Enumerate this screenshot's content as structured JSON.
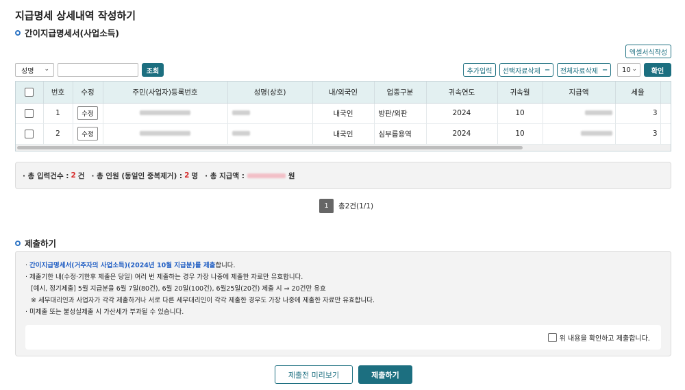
{
  "page_title": "지급명세 상세내역 작성하기",
  "section1_title": "간이지급명세서(사업소득)",
  "excel_button": "엑셀서식작성",
  "search": {
    "select_value": "성명",
    "query_button": "조회"
  },
  "toolbar": {
    "add_button": "추가입력",
    "delete_selected": "선택자료삭제",
    "delete_all": "전체자료삭제",
    "page_size": "10",
    "confirm_button": "확인"
  },
  "table": {
    "headers": [
      "번호",
      "수정",
      "주민(사업자)등록번호",
      "성명(상호)",
      "내/외국인",
      "업종구분",
      "귀속연도",
      "귀속월",
      "지급액",
      "세율"
    ],
    "rows": [
      {
        "no": "1",
        "edit": "수정",
        "nationality": "내국인",
        "biz_type": "방판/외판",
        "year": "2024",
        "month": "10",
        "rate": "3"
      },
      {
        "no": "2",
        "edit": "수정",
        "nationality": "내국인",
        "biz_type": "심부름용역",
        "year": "2024",
        "month": "10",
        "rate": "3"
      }
    ]
  },
  "summary": {
    "count_label": "· 총 입력건수 :",
    "count_value": "2",
    "count_unit": "건",
    "persons_label": "· 총 인원 (동일인 중복제거) :",
    "persons_value": "2",
    "persons_unit": "명",
    "amount_label": "· 총 지급액 :",
    "amount_unit": "원"
  },
  "pagination": {
    "current": "1",
    "total_text": "총2건(1/1)"
  },
  "section2_title": "제출하기",
  "notice": {
    "line1_blue": "간이지급명세서(거주자의 사업소득)(2024년 10월 지급분)를 제출",
    "line1_rest": "합니다.",
    "line2": "· 제출기한 내(수정·기한후 제출은 당일) 여러 번 제출하는 경우 가장 나중에 제출한 자료만 유효합니다.",
    "line3": "[예시, 정기제출] 5월 지급분을 6월 7일(80건), 6월 20일(100건), 6월25일(20건) 제출 시 ⇒ 20건만 유효",
    "line4": "※ 세무대리인과 사업자가 각각 제출하거나 서로 다른 세무대리인이 각각 제출한 경우도 가장 나중에 제출한 자료만 유효합니다.",
    "line5": "· 미제출 또는 불성실제출 시 가산세가 부과될 수 있습니다.",
    "confirm_label": "위 내용을 확인하고 제출합니다."
  },
  "buttons": {
    "preview": "제출전 미리보기",
    "submit": "제출하기"
  },
  "colors": {
    "accent": "#1c6f80",
    "header_bg": "#e3f0f1",
    "red": "#d62a2a",
    "blue": "#2360c4"
  }
}
